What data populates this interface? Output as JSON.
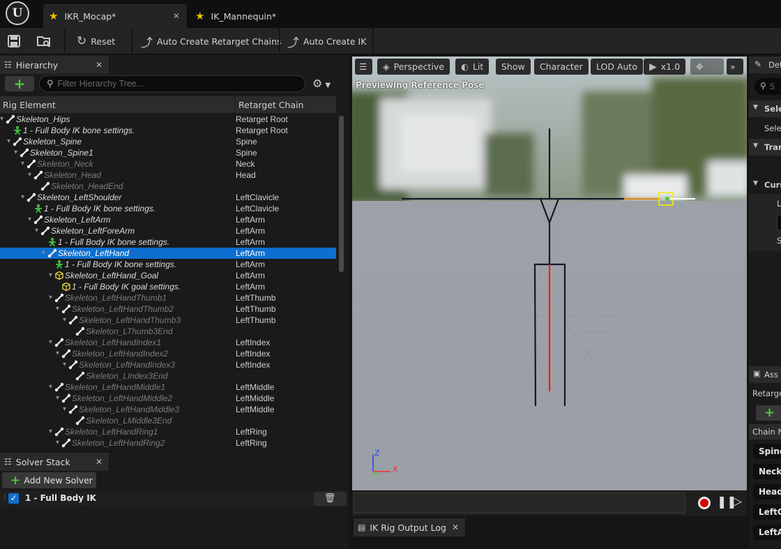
{
  "tabs": [
    {
      "label": "IKR_Mocap*",
      "active": true
    },
    {
      "label": "IK_Mannequin*",
      "active": false
    }
  ],
  "logo_text": "U",
  "toolbar": {
    "reset": "Reset",
    "auto_chains": "Auto Create Retarget Chains",
    "auto_ik": "Auto Create IK"
  },
  "hierarchy": {
    "title": "Hierarchy",
    "search_placeholder": "Filter Hierarchy Tree...",
    "col_element": "Rig Element",
    "col_chain": "Retarget Chain",
    "rows": [
      {
        "name": "Skeleton_Hips",
        "chain": "Retarget Root",
        "depth": 0,
        "kind": "bone",
        "tone": "bright",
        "arrow": true
      },
      {
        "name": "1 - Full Body IK bone settings.",
        "chain": "Retarget Root",
        "depth": 1,
        "kind": "setting",
        "tone": "bright",
        "arrow": false
      },
      {
        "name": "Skeleton_Spine",
        "chain": "Spine",
        "depth": 1,
        "kind": "bone",
        "tone": "bright",
        "arrow": true
      },
      {
        "name": "Skeleton_Spine1",
        "chain": "Spine",
        "depth": 2,
        "kind": "bone",
        "tone": "bright",
        "arrow": true
      },
      {
        "name": "Skeleton_Neck",
        "chain": "Neck",
        "depth": 3,
        "kind": "bone",
        "tone": "dim",
        "arrow": true
      },
      {
        "name": "Skeleton_Head",
        "chain": "Head",
        "depth": 4,
        "kind": "bone",
        "tone": "dim",
        "arrow": true
      },
      {
        "name": "Skeleton_HeadEnd",
        "chain": "",
        "depth": 5,
        "kind": "bone",
        "tone": "dim",
        "arrow": false
      },
      {
        "name": "Skeleton_LeftShoulder",
        "chain": "LeftClavicle",
        "depth": 3,
        "kind": "bone",
        "tone": "bright",
        "arrow": true
      },
      {
        "name": "1 - Full Body IK bone settings.",
        "chain": "LeftClavicle",
        "depth": 4,
        "kind": "setting",
        "tone": "bright",
        "arrow": false
      },
      {
        "name": "Skeleton_LeftArm",
        "chain": "LeftArm",
        "depth": 4,
        "kind": "bone",
        "tone": "bright",
        "arrow": true
      },
      {
        "name": "Skeleton_LeftForeArm",
        "chain": "LeftArm",
        "depth": 5,
        "kind": "bone",
        "tone": "bright",
        "arrow": true
      },
      {
        "name": "1 - Full Body IK bone settings.",
        "chain": "LeftArm",
        "depth": 6,
        "kind": "setting",
        "tone": "bright",
        "arrow": false
      },
      {
        "name": "Skeleton_LeftHand",
        "chain": "LeftArm",
        "depth": 6,
        "kind": "bone",
        "tone": "sel",
        "arrow": true,
        "selected": true
      },
      {
        "name": "1 - Full Body IK bone settings.",
        "chain": "LeftArm",
        "depth": 7,
        "kind": "setting",
        "tone": "bright",
        "arrow": false
      },
      {
        "name": "Skeleton_LeftHand_Goal",
        "chain": "LeftArm",
        "depth": 7,
        "kind": "goal",
        "tone": "bright",
        "arrow": true
      },
      {
        "name": "1 - Full Body IK goal settings.",
        "chain": "LeftArm",
        "depth": 8,
        "kind": "goal",
        "tone": "bright",
        "arrow": false
      },
      {
        "name": "Skeleton_LeftHandThumb1",
        "chain": "LeftThumb",
        "depth": 7,
        "kind": "bone",
        "tone": "dim",
        "arrow": true
      },
      {
        "name": "Skeleton_LeftHandThumb2",
        "chain": "LeftThumb",
        "depth": 8,
        "kind": "bone",
        "tone": "dim",
        "arrow": true
      },
      {
        "name": "Skeleton_LeftHandThumb3",
        "chain": "LeftThumb",
        "depth": 9,
        "kind": "bone",
        "tone": "dim",
        "arrow": true
      },
      {
        "name": "Skeleton_LThumb3End",
        "chain": "",
        "depth": 10,
        "kind": "bone",
        "tone": "dim",
        "arrow": false
      },
      {
        "name": "Skeleton_LeftHandIndex1",
        "chain": "LeftIndex",
        "depth": 7,
        "kind": "bone",
        "tone": "dim",
        "arrow": true
      },
      {
        "name": "Skeleton_LeftHandIndex2",
        "chain": "LeftIndex",
        "depth": 8,
        "kind": "bone",
        "tone": "dim",
        "arrow": true
      },
      {
        "name": "Skeleton_LeftHandIndex3",
        "chain": "LeftIndex",
        "depth": 9,
        "kind": "bone",
        "tone": "dim",
        "arrow": true
      },
      {
        "name": "Skeleton_LIndex3End",
        "chain": "",
        "depth": 10,
        "kind": "bone",
        "tone": "dim",
        "arrow": false
      },
      {
        "name": "Skeleton_LeftHandMiddle1",
        "chain": "LeftMiddle",
        "depth": 7,
        "kind": "bone",
        "tone": "dim",
        "arrow": true
      },
      {
        "name": "Skeleton_LeftHandMiddle2",
        "chain": "LeftMiddle",
        "depth": 8,
        "kind": "bone",
        "tone": "dim",
        "arrow": true
      },
      {
        "name": "Skeleton_LeftHandMiddle3",
        "chain": "LeftMiddle",
        "depth": 9,
        "kind": "bone",
        "tone": "dim",
        "arrow": true
      },
      {
        "name": "Skeleton_LMiddle3End",
        "chain": "",
        "depth": 10,
        "kind": "bone",
        "tone": "dim",
        "arrow": false
      },
      {
        "name": "Skeleton_LeftHandRing1",
        "chain": "LeftRing",
        "depth": 7,
        "kind": "bone",
        "tone": "dim",
        "arrow": true
      },
      {
        "name": "Skeleton_LeftHandRing2",
        "chain": "LeftRing",
        "depth": 8,
        "kind": "bone",
        "tone": "dim",
        "arrow": true
      }
    ]
  },
  "solver": {
    "title": "Solver Stack",
    "add_label": "Add New Solver",
    "item_label": "1 - Full Body IK",
    "checked": true
  },
  "viewport": {
    "perspective": "Perspective",
    "lit": "Lit",
    "show": "Show",
    "character": "Character",
    "lod": "LOD Auto",
    "speed": "x1.0",
    "preview_text": "Previewing Reference Pose",
    "axis_z": "Z",
    "axis_x": "X"
  },
  "output_log": {
    "title": "IK Rig Output Log"
  },
  "right": {
    "details_tab": "Det",
    "search_ph": "S",
    "sec1": "Sele",
    "sec1_row": "Sele",
    "sec2": "Tran",
    "sec3": "Curr",
    "r1": "L",
    "r2": "S",
    "asset_tab": "Ass",
    "retarget_label": "Retarge",
    "chain_header": "Chain N",
    "chains": [
      "Spine",
      "Neck",
      "Head",
      "LeftC",
      "LeftA"
    ]
  },
  "colors": {
    "accent": "#0e6fd0",
    "add_green": "#4fc53d",
    "record_red": "#d40000"
  }
}
